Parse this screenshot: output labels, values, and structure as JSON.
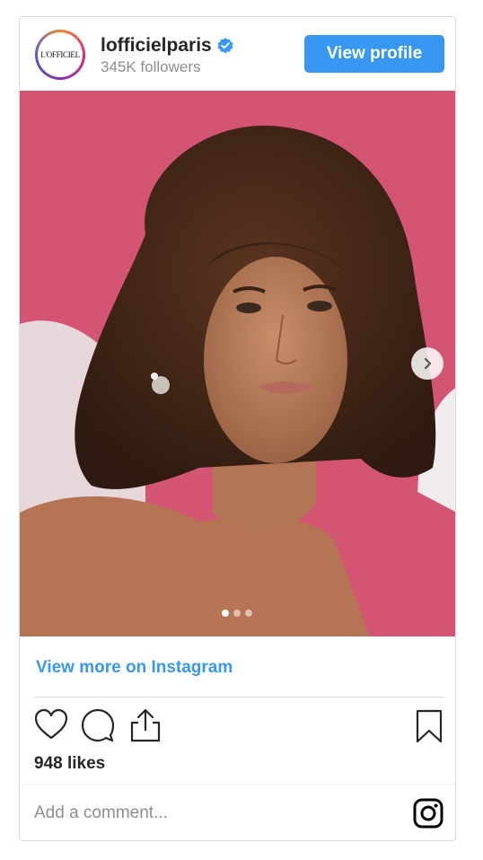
{
  "header": {
    "avatar_text": "L'OFFICIEL",
    "username": "lofficielparis",
    "followers": "345K followers",
    "view_profile_label": "View profile"
  },
  "carousel": {
    "total_slides": 3,
    "active_slide": 1
  },
  "footer": {
    "view_more_label": "View more on Instagram",
    "likes": "948 likes",
    "comment_placeholder": "Add a comment..."
  },
  "icons": [
    "verified-badge-icon",
    "chevron-right-icon",
    "heart-icon",
    "comment-icon",
    "share-icon",
    "bookmark-icon",
    "instagram-icon"
  ],
  "colors": {
    "accent": "#3897f0",
    "background": "#ffffff",
    "border": "#dbdbdb",
    "muted": "#8e8e8e"
  }
}
